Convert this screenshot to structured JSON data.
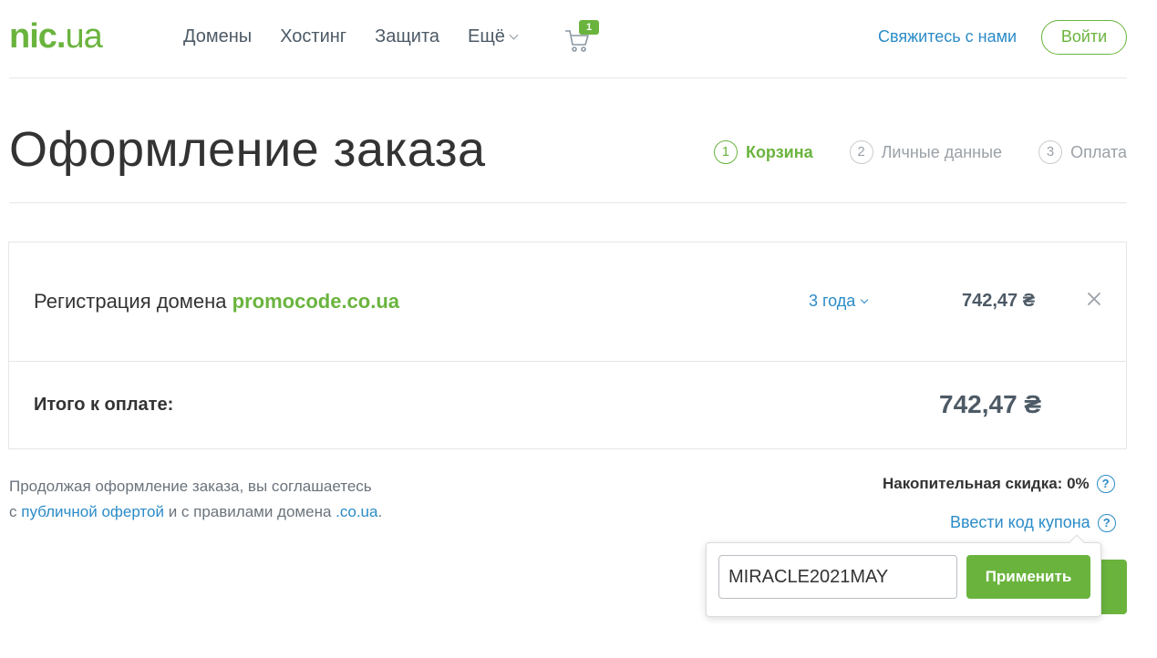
{
  "header": {
    "logo": {
      "part1": "nic",
      "dot": ".",
      "part2": "ua"
    },
    "nav": [
      "Домены",
      "Хостинг",
      "Защита",
      "Ещё"
    ],
    "cart_count": "1",
    "contact_label": "Свяжитесь с нами",
    "login_label": "Войти"
  },
  "page": {
    "title": "Оформление заказа",
    "steps": [
      {
        "num": "1",
        "label": "Корзина",
        "active": true
      },
      {
        "num": "2",
        "label": "Личные данные",
        "active": false
      },
      {
        "num": "3",
        "label": "Оплата",
        "active": false
      }
    ]
  },
  "order": {
    "item_prefix": "Регистрация домена ",
    "domain": "promocode.co.ua",
    "period": "3 года",
    "price": "742,47 ₴",
    "total_label": "Итого к оплате:",
    "total_price": "742,47 ₴"
  },
  "agreement": {
    "line1": "Продолжая оформление заказа, вы соглашаетесь",
    "line2_prefix": "с ",
    "offer_link": "публичной офертой",
    "line2_middle": " и с правилами домена ",
    "domain_link": ".co.ua",
    "line2_suffix": "."
  },
  "discount": {
    "label": "Накопительная скидка: 0%",
    "help": "?"
  },
  "coupon": {
    "link_label": "Ввести код купона",
    "help": "?",
    "input_value": "MIRACLE2021MAY",
    "apply_label": "Применить"
  },
  "colors": {
    "brand_green": "#6ab43e",
    "link_blue": "#2b8bc8",
    "text_dark": "#333333",
    "text_muted": "#9aa1a7"
  }
}
